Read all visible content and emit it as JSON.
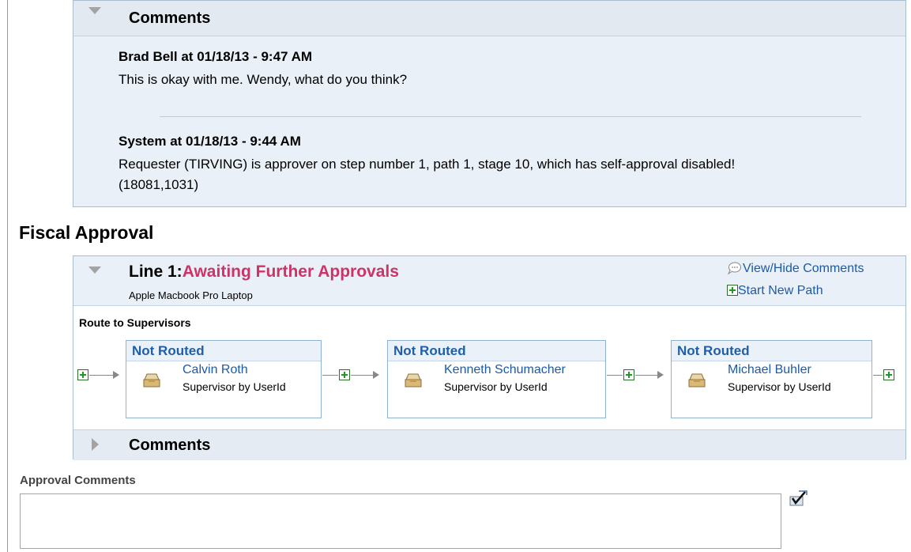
{
  "comments_section": {
    "title": "Comments",
    "entries": [
      {
        "author": "Brad Bell at 01/18/13 - 9:47 AM",
        "text": "This is okay with me. Wendy, what do you think?"
      },
      {
        "author": "System at 01/18/13 - 9:44 AM",
        "text": "Requester (TIRVING) is approver on step number 1, path 1, stage 10, which has self-approval disabled! (18081,1031)"
      }
    ]
  },
  "fiscal_approval": {
    "title": "Fiscal Approval",
    "line": {
      "label": "Line 1:",
      "status": "Awaiting Further Approvals",
      "item": "Apple Macbook Pro Laptop",
      "view_hide_comments": "View/Hide Comments",
      "start_new_path": "Start New Path",
      "route_title": "Route to Supervisors",
      "steps": [
        {
          "status": "Not Routed",
          "approver": "Calvin Roth",
          "role": "Supervisor by UserId"
        },
        {
          "status": "Not Routed",
          "approver": "Kenneth Schumacher",
          "role": "Supervisor by UserId"
        },
        {
          "status": "Not Routed",
          "approver": "Michael Buhler",
          "role": "Supervisor by UserId"
        }
      ],
      "comments_title": "Comments"
    }
  },
  "approval_comments": {
    "label": "Approval Comments",
    "value": ""
  },
  "colors": {
    "status_text": "#cc3366",
    "link": "#1d5aa5",
    "step_status": "#1f5fa8",
    "panel_bg": "#eaf0f7",
    "panel_border": "#a9bdd0"
  },
  "icons": [
    "collapse-triangle-icon",
    "expand-triangle-icon",
    "chat-bubble-icon",
    "add-plus-icon",
    "inbox-tray-icon",
    "spellcheck-icon"
  ]
}
